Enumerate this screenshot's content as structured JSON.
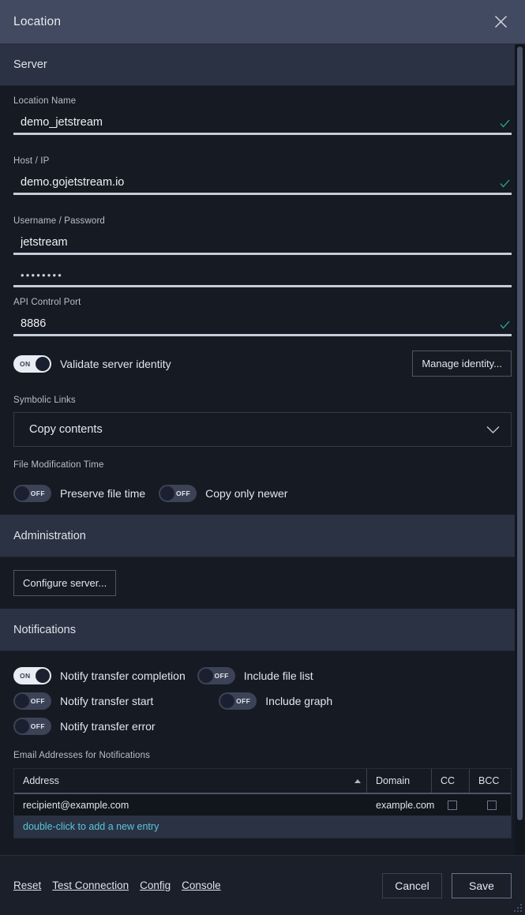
{
  "window": {
    "title": "Location",
    "close_icon": "close-icon"
  },
  "sections": {
    "server": {
      "title": "Server"
    },
    "administration": {
      "title": "Administration"
    },
    "notifications": {
      "title": "Notifications"
    }
  },
  "fields": {
    "location_name": {
      "label": "Location Name",
      "value": "demo_jetstream",
      "valid": "✓"
    },
    "host_ip": {
      "label": "Host / IP",
      "value": "demo.gojetstream.io",
      "valid": "✓"
    },
    "user_pass": {
      "label": "Username / Password",
      "username": "jetstream",
      "password": "••••••••"
    },
    "api_port": {
      "label": "API Control Port",
      "value": "8886",
      "valid": "✓"
    }
  },
  "server_options": {
    "validate_identity": {
      "label": "Validate server identity",
      "state": "ON"
    },
    "manage_identity_button": "Manage identity...",
    "symbolic_links": {
      "label": "Symbolic Links",
      "value": "Copy contents"
    },
    "file_mod_time": {
      "label": "File Modification Time"
    },
    "preserve_file_time": {
      "label": "Preserve file time",
      "state": "OFF"
    },
    "copy_only_newer": {
      "label": "Copy only newer",
      "state": "OFF"
    }
  },
  "administration": {
    "configure_server_button": "Configure server..."
  },
  "notifications": {
    "toggles": [
      {
        "label": "Notify transfer completion",
        "state": "ON"
      },
      {
        "label": "Include file list",
        "state": "OFF"
      },
      {
        "label": "Notify transfer start",
        "state": "OFF"
      },
      {
        "label": "Include graph",
        "state": "OFF"
      },
      {
        "label": "Notify transfer error",
        "state": "OFF"
      }
    ],
    "email_table": {
      "label": "Email Addresses for Notifications",
      "columns": [
        "Address",
        "Domain",
        "CC",
        "BCC"
      ],
      "rows": [
        {
          "address": "recipient@example.com",
          "domain": "example.com",
          "cc": false,
          "bcc": false
        }
      ],
      "new_entry_hint": "double-click to add a new entry"
    }
  },
  "footer": {
    "links": [
      "Reset",
      "Test Connection",
      "Config",
      "Console"
    ],
    "cancel": "Cancel",
    "save": "Save"
  },
  "colors": {
    "titlebar": "#414a60",
    "section_header": "#2b3243",
    "background": "#161a22",
    "valid_check": "#2aa99a",
    "accent_link": "#56c8d8"
  }
}
